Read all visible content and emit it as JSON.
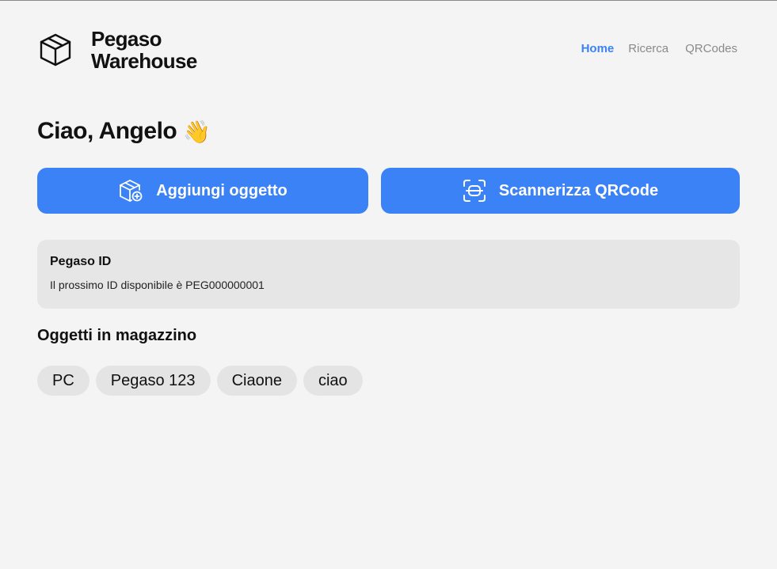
{
  "brand": {
    "name_line1": "Pegaso",
    "name_line2": "Warehouse",
    "icon": "package-box-icon"
  },
  "nav": {
    "items": [
      {
        "label": "Home",
        "active": true
      },
      {
        "label": "Ricerca",
        "active": false
      },
      {
        "label": "QRCodes",
        "active": false
      }
    ]
  },
  "greeting": {
    "text": "Ciao, Angelo",
    "emoji": "👋"
  },
  "actions": {
    "add": {
      "label": "Aggiungi oggetto",
      "icon": "package-plus-icon"
    },
    "scan": {
      "label": "Scannerizza QRCode",
      "icon": "scan-icon"
    }
  },
  "pegaso_id": {
    "title": "Pegaso ID",
    "text": "Il prossimo ID disponibile è PEG000000001"
  },
  "inventory": {
    "title": "Oggetti in magazzino",
    "items": [
      "PC",
      "Pegaso 123",
      "Ciaone",
      "ciao"
    ]
  },
  "colors": {
    "accent": "#3b82f6",
    "background": "#f4f4f4",
    "card": "#e6e6e6",
    "chip": "#e4e4e4",
    "muted_text": "#8a8a8a"
  }
}
